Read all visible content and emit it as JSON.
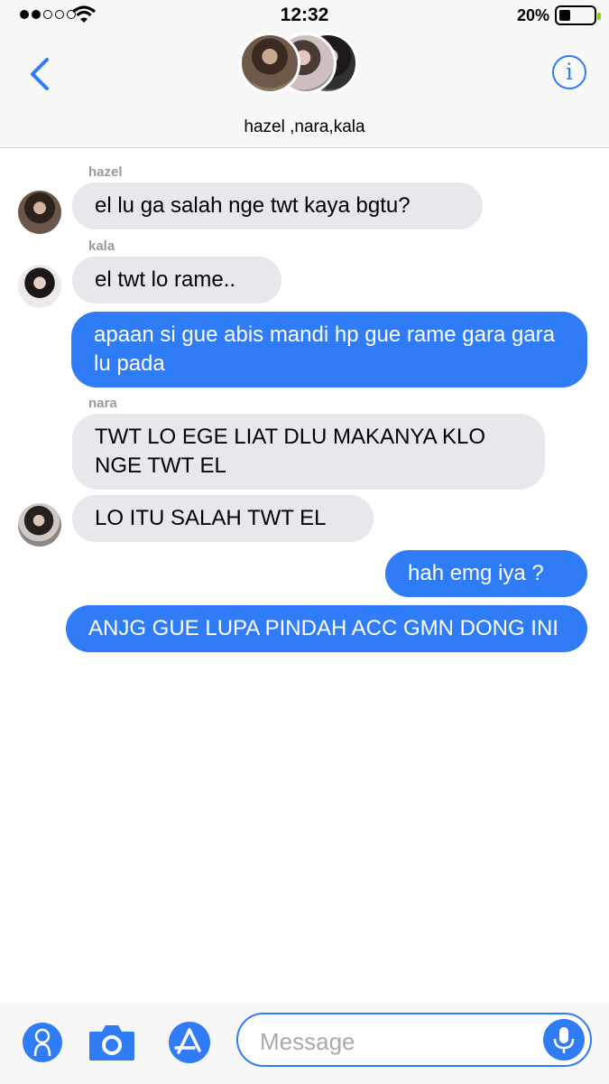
{
  "status_bar": {
    "time": "12:32",
    "battery_percent": "20%",
    "battery_level": 0.2,
    "signal_bars_filled": 2,
    "signal_bars_total": 5
  },
  "header": {
    "group_names": "hazel ,nara,kala",
    "back_icon": "chevron-left-icon",
    "info_label": "i"
  },
  "messages": [
    {
      "sender": "hazel",
      "direction": "incoming",
      "text": "el lu ga salah nge twt kaya bgtu?"
    },
    {
      "sender": "kala",
      "direction": "incoming",
      "text": "el twt lo rame.."
    },
    {
      "direction": "outgoing",
      "text": "apaan si gue abis mandi hp gue rame gara gara lu pada"
    },
    {
      "sender": "nara",
      "direction": "incoming",
      "text": "TWT LO EGE LIAT DLU MAKANYA KLO NGE TWT EL"
    },
    {
      "sender": "nara",
      "direction": "incoming",
      "text": "LO ITU SALAH TWT EL"
    },
    {
      "direction": "outgoing",
      "text": "hah emg iya ?"
    },
    {
      "direction": "outgoing",
      "text": "ANJG GUE LUPA PINDAH ACC GMN DONG INI"
    }
  ],
  "composer": {
    "placeholder": "Message",
    "icons": [
      "contact-icon",
      "camera-icon",
      "app-store-icon",
      "microphone-icon"
    ]
  },
  "colors": {
    "accent": "#2f7cf6",
    "incoming_bubble": "#e7e7ec",
    "sender_label": "#9a9a9f"
  }
}
